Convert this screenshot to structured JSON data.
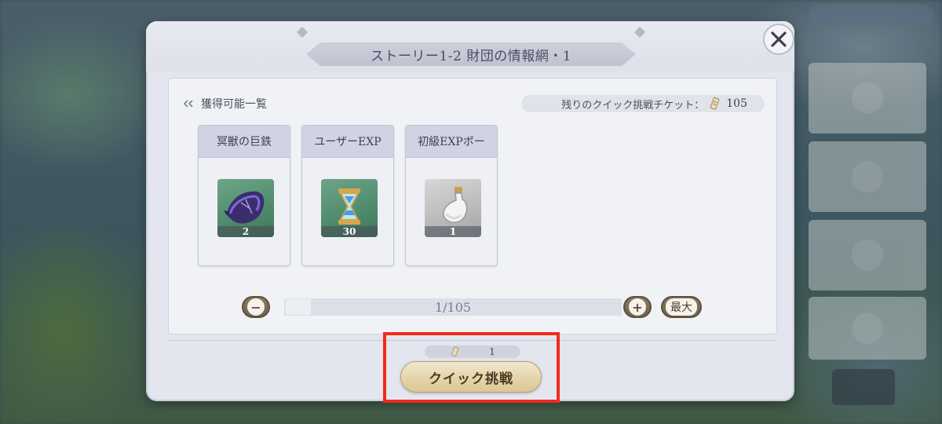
{
  "dialog": {
    "title": "ストーリー1-2  財団の情報網・1",
    "close_icon": "close-icon"
  },
  "rewards": {
    "section_label": "獲得可能一覧",
    "ticket_label": "残りのクイック挑戦チケット：",
    "ticket_count": "105",
    "items": [
      {
        "name": "冥獣の巨鉄",
        "qty": "2",
        "icon": "claw-ore-icon"
      },
      {
        "name": "ユーザーEXP",
        "qty": "30",
        "icon": "hourglass-icon"
      },
      {
        "name": "初級EXPポー",
        "qty": "1",
        "icon": "potion-bottle-icon"
      }
    ]
  },
  "slider": {
    "value_text": "1/105",
    "minus": "−",
    "plus": "+",
    "max_label": "最大"
  },
  "footer": {
    "cost": "1",
    "quick_button": "クイック挑戦"
  },
  "colors": {
    "highlight": "#f02b1c",
    "button_gold": "#e6d6ad"
  }
}
